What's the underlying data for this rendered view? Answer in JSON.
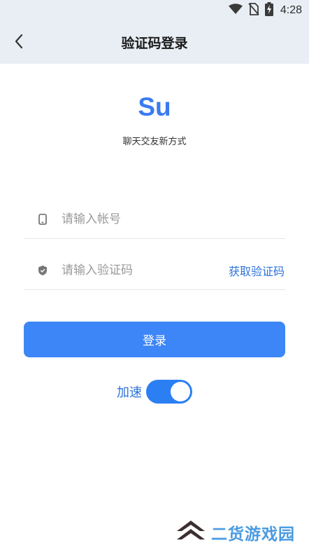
{
  "status_bar": {
    "time": "4:28",
    "icons": [
      "wifi-icon",
      "no-sim-icon",
      "battery-charging-icon"
    ]
  },
  "nav": {
    "back_icon": "chevron-left-icon",
    "title": "验证码登录"
  },
  "brand": {
    "logo_text": "Su",
    "slogan": "聊天交友新方式",
    "color": "#3b7bf0"
  },
  "form": {
    "account": {
      "icon": "phone-icon",
      "placeholder": "请输入帐号",
      "value": ""
    },
    "code": {
      "icon": "shield-icon",
      "placeholder": "请输入验证码",
      "value": "",
      "get_code_label": "获取验证码"
    },
    "login_label": "登录",
    "login_color": "#3d86f7"
  },
  "speed": {
    "label": "加速",
    "enabled": true
  },
  "watermark": {
    "text": "二货游戏园",
    "icon": "chevron-stack-logo"
  }
}
